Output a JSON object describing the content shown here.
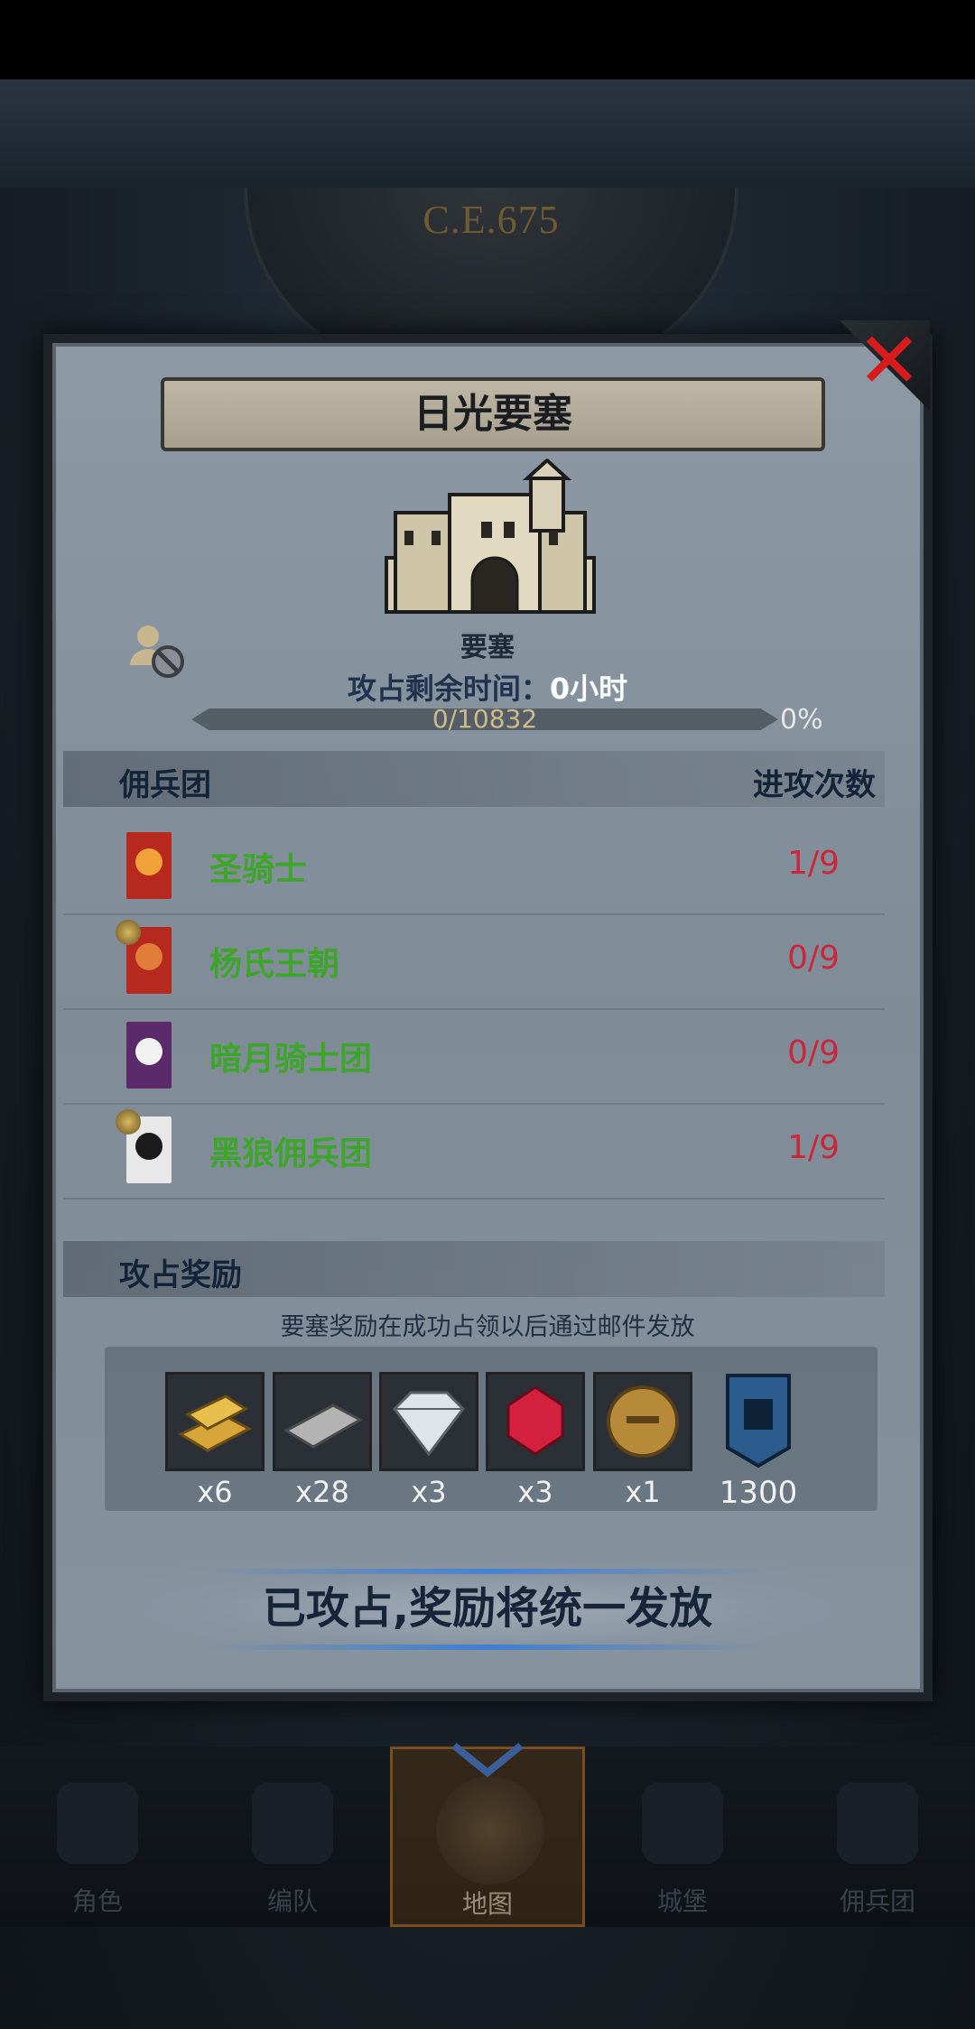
{
  "era": {
    "year_label": "C.E.675"
  },
  "dialog": {
    "title": "日光要塞",
    "fortress_type": "要塞",
    "capture_time": {
      "label": "攻占剩余时间：",
      "value": "0",
      "unit": "小时"
    },
    "progress": {
      "text": "0/10832",
      "percent": "0%",
      "current": 0,
      "max": 10832
    }
  },
  "mercenary_section": {
    "header_left": "佣兵团",
    "header_right": "进攻次数",
    "rows": [
      {
        "name": "圣骑士",
        "count": "1/9",
        "banner_color": "#b7281f",
        "emblem_color": "#f0a13a",
        "emblem_icon": "phoenix-icon",
        "has_avatar": false
      },
      {
        "name": "杨氏王朝",
        "count": "0/9",
        "banner_color": "#b7281f",
        "emblem_color": "#e27c3a",
        "emblem_icon": "eye-icon",
        "has_avatar": true
      },
      {
        "name": "暗月骑士团",
        "count": "0/9",
        "banner_color": "#5a2a6a",
        "emblem_color": "#f2f2f2",
        "emblem_icon": "crescent-moon-icon",
        "has_avatar": false
      },
      {
        "name": "黑狼佣兵团",
        "count": "1/9",
        "banner_color": "#e8e8e8",
        "emblem_color": "#1b1b1b",
        "emblem_icon": "wolf-icon",
        "has_avatar": true
      }
    ]
  },
  "reward_section": {
    "header": "攻占奖励",
    "note": "要塞奖励在成功占领以后通过邮件发放",
    "items": [
      {
        "icon": "gold-bar-icon",
        "qty": "x6",
        "color": "#d6a63a"
      },
      {
        "icon": "iron-bar-icon",
        "qty": "x28",
        "color": "#a6a6a6"
      },
      {
        "icon": "diamond-icon",
        "qty": "x3",
        "color": "#d8dde2"
      },
      {
        "icon": "ruby-icon",
        "qty": "x3",
        "color": "#d3203e"
      },
      {
        "icon": "knight-helmet-coin-icon",
        "qty": "x1",
        "color": "#b78a3a"
      },
      {
        "icon": "fortress-fame-banner-icon",
        "qty": "1300",
        "color": "#2c5b8e"
      }
    ]
  },
  "status_banner": "已攻占,奖励将统一发放",
  "bottom_nav": {
    "items": [
      {
        "label": "角色",
        "icon": "knight-icon"
      },
      {
        "label": "编队",
        "icon": "helmet-icon"
      },
      {
        "label": "地图",
        "icon": "map-compass-icon",
        "active": true
      },
      {
        "label": "城堡",
        "icon": "castle-icon"
      },
      {
        "label": "佣兵团",
        "icon": "mercenary-ship-icon"
      }
    ]
  }
}
